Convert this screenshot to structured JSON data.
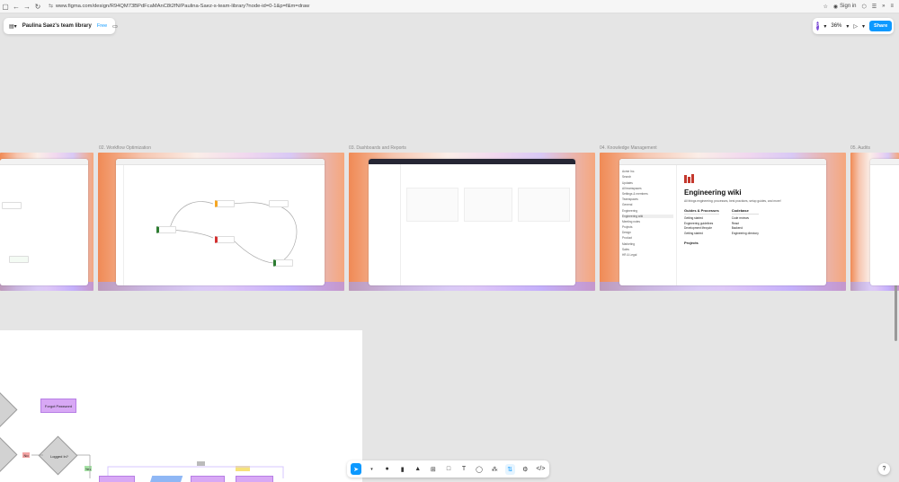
{
  "browser": {
    "url": "www.figma.com/design/R94QM73BPdFcaMAnC8t2fN/Paulina-Saez-s-team-library?node-id=0-1&p=f&m=draw",
    "sign_in": "Sign in"
  },
  "figma": {
    "team_name": "Paulina Saez's team library",
    "plan": "Free",
    "avatar_letter": "P",
    "zoom": "36%",
    "share_label": "Share"
  },
  "frames": [
    {
      "label": "02. Workflow Optimization"
    },
    {
      "label": "03. Dashboards and Reports"
    },
    {
      "label": "04. Knowledge Management"
    },
    {
      "label": "05. Audits"
    }
  ],
  "wiki": {
    "title": "Engineering wiki",
    "subtitle": "All things engineering: processes, best practices, setup guides, and more!",
    "guides_heading": "Guides & Processes",
    "guides": [
      "Getting started",
      "Engineering guidelines",
      "Development lifecycle",
      "Getting started"
    ],
    "codebase_heading": "Codebase",
    "codebase": [
      "Code reviews",
      "React",
      "Backend",
      "Engineering directory"
    ],
    "projects_heading": "Projects",
    "sidebar": [
      "Acme Inc.",
      "Search",
      "Updates",
      "All teamspaces",
      "Settings & members",
      "Teamspaces",
      "General",
      "Engineering",
      "Engineering wiki",
      "Meeting notes",
      "Projects",
      "Design",
      "Product",
      "Marketing",
      "Sales",
      "HR & Legal"
    ]
  },
  "flowchart": {
    "forgot_password": "Forgot Password",
    "logged_in": "Logged In?",
    "yes_label": "Yes",
    "no_label": "No"
  },
  "toolbar": {
    "move_icon": "cursor-icon",
    "items": [
      "frame-icon",
      "shape-icon",
      "pen-icon",
      "text-icon",
      "comment-icon",
      "components-icon",
      "dev-mode-icon",
      "code-icon"
    ]
  },
  "help": "?"
}
